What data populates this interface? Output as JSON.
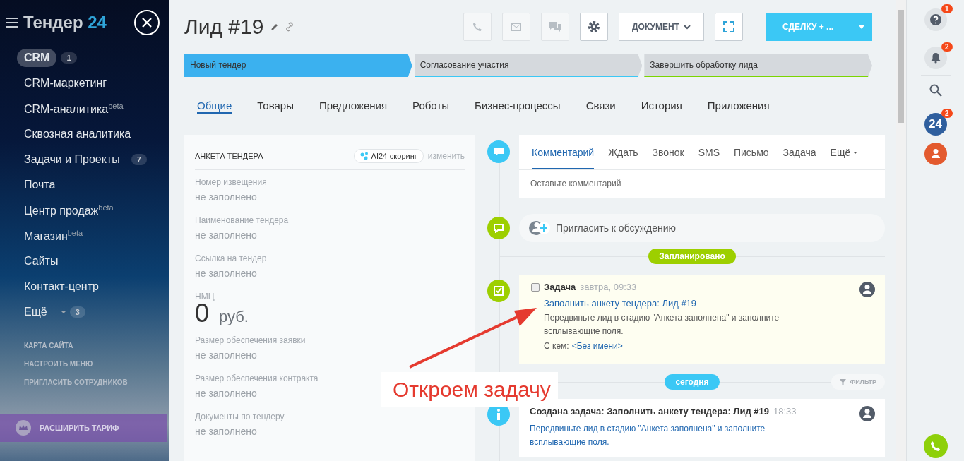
{
  "sidebar": {
    "logo": {
      "name": "Тендер",
      "suffix": "24"
    },
    "items": [
      {
        "label": "CRM",
        "badge": "1",
        "selected": true
      },
      {
        "label": "CRM-маркетинг",
        "selected": false
      },
      {
        "label": "CRM-аналитика",
        "sup": "beta",
        "selected": false
      },
      {
        "label": "Сквозная аналитика",
        "selected": false
      },
      {
        "label": "Задачи и Проекты",
        "badge": "7",
        "selected": false
      },
      {
        "label": "Почта",
        "selected": false
      },
      {
        "label": "Центр продаж",
        "sup": "beta",
        "selected": false
      },
      {
        "label": "Магазин",
        "sup": "beta",
        "selected": false
      },
      {
        "label": "Сайты",
        "selected": false
      },
      {
        "label": "Контакт-центр",
        "selected": false
      },
      {
        "label": "Ещё",
        "badge": "3",
        "dropdown": true,
        "selected": false
      }
    ],
    "links": [
      "КАРТА САЙТА",
      "НАСТРОИТЬ МЕНЮ",
      "ПРИГЛАСИТЬ СОТРУДНИКОВ"
    ],
    "upgrade": "РАСШИРИТЬ ТАРИФ"
  },
  "header": {
    "title": "Лид #19",
    "document_button": "ДОКУМЕНТ",
    "convert_button": "СДЕЛКУ + ..."
  },
  "stages": [
    {
      "label": "Новый тендер",
      "color": "#3bb1ef",
      "selected": true
    },
    {
      "label": "Согласование участия",
      "color": "#3bc8f5",
      "selected": false
    },
    {
      "label": "Завершить обработку лида",
      "color": "#7bd500",
      "selected": false
    }
  ],
  "tabs": [
    {
      "label": "Общие",
      "selected": true
    },
    {
      "label": "Товары",
      "selected": false
    },
    {
      "label": "Предложения",
      "selected": false
    },
    {
      "label": "Роботы",
      "selected": false
    },
    {
      "label": "Бизнес-процессы",
      "selected": false
    },
    {
      "label": "Связи",
      "selected": false
    },
    {
      "label": "История",
      "selected": false
    },
    {
      "label": "Приложения",
      "selected": false
    }
  ],
  "form": {
    "title": "АНКЕТА ТЕНДЕРА",
    "scoring": "AI24-скоринг",
    "edit": "изменить",
    "fields": [
      {
        "kind": "text",
        "label": "Номер извещения",
        "value": "не заполнено"
      },
      {
        "kind": "text",
        "label": "Наименование тендера",
        "value": "не заполнено"
      },
      {
        "kind": "text",
        "label": "Ссылка на тендер",
        "value": "не заполнено"
      },
      {
        "kind": "money",
        "label": "НМЦ",
        "value": "0",
        "currency": "руб."
      },
      {
        "kind": "text",
        "label": "Размер обеспечения заявки",
        "value": "не заполнено"
      },
      {
        "kind": "text",
        "label": "Размер обеспечения контракта",
        "value": "не заполнено"
      },
      {
        "kind": "text",
        "label": "Документы по тендеру",
        "value": "не заполнено"
      }
    ]
  },
  "timeline": {
    "composer": {
      "tabs": [
        {
          "label": "Комментарий",
          "selected": true
        },
        {
          "label": "Ждать",
          "selected": false
        },
        {
          "label": "Звонок",
          "selected": false
        },
        {
          "label": "SMS",
          "selected": false
        },
        {
          "label": "Письмо",
          "selected": false
        },
        {
          "label": "Задача",
          "selected": false
        },
        {
          "label": "Ещё",
          "selected": false
        }
      ],
      "placeholder": "Оставьте комментарий"
    },
    "invite": "Пригласить к обсуждению",
    "planned_label": "Запланировано",
    "task": {
      "title": "Задача",
      "time": "завтра, 09:33",
      "checked": false,
      "link": "Заполнить анкету тендера: Лид #19",
      "description": "Передвиньте лид в стадию \"Анкета заполнена\" и заполните всплывающие поля.",
      "with_label": "С кем:",
      "with_value": "<Без имени>"
    },
    "today_label": "сегодня",
    "filter": "ФИЛЬТР",
    "history": [
      {
        "title": "Создана задача: Заполнить анкету тендера: Лид #19",
        "time": "18:33",
        "text": "Передвиньте лид в стадию \"Анкета заполнена\" и заполните всплывающие поля."
      }
    ]
  },
  "annotation": "Откроем задачу",
  "right_panel": {
    "help_badge": "1",
    "notifications_badge": "2",
    "app_label": "24",
    "app_badge": "2"
  }
}
